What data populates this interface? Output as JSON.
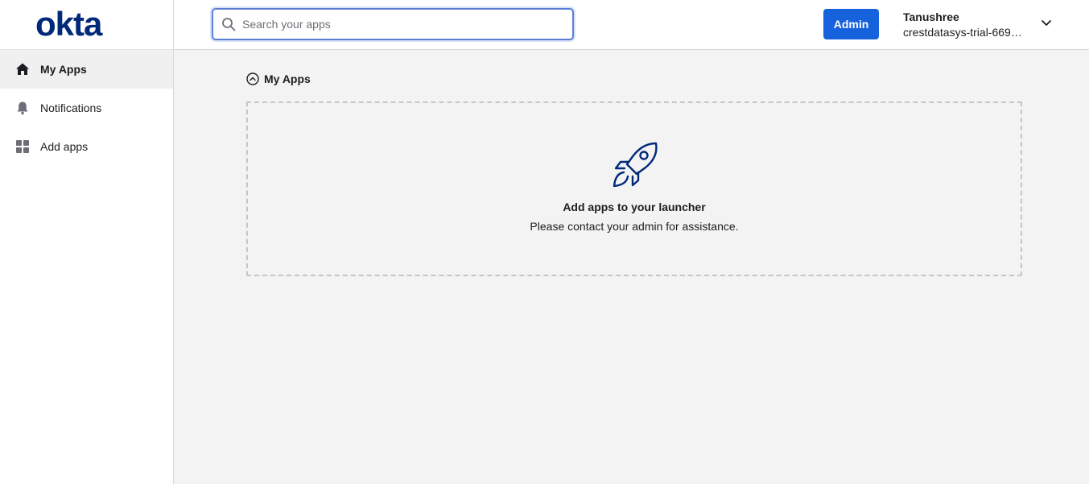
{
  "brand": {
    "logo_text": "okta",
    "logo_color": "#00297a"
  },
  "sidebar": {
    "items": [
      {
        "label": "My Apps",
        "icon": "home-icon",
        "active": true
      },
      {
        "label": "Notifications",
        "icon": "bell-icon",
        "active": false
      },
      {
        "label": "Add apps",
        "icon": "grid-icon",
        "active": false
      }
    ]
  },
  "header": {
    "search": {
      "placeholder": "Search your apps",
      "value": ""
    },
    "admin_label": "Admin",
    "user": {
      "name": "Tanushree",
      "org": "crestdatasys-trial-669…"
    }
  },
  "main": {
    "section_title": "My Apps",
    "empty_state": {
      "title": "Add apps to your launcher",
      "subtitle": "Please contact your admin for assistance.",
      "icon": "rocket-icon"
    }
  },
  "colors": {
    "accent": "#1662dd",
    "search_focus": "#5d7fd3",
    "icon_navy": "#00297a"
  }
}
